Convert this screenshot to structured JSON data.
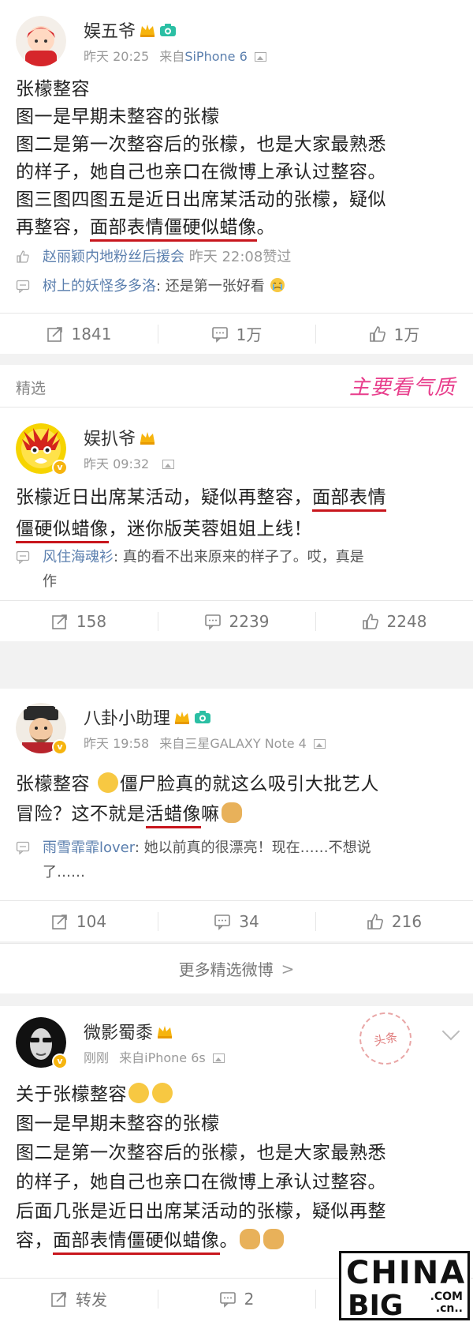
{
  "posts": [
    {
      "username": "娱五爷",
      "time": "昨天 20:25",
      "source_prefix": "来自",
      "source": "SiPhone 6",
      "body_lines": [
        {
          "pre": "张檬整容",
          "hl": "",
          "post": ""
        },
        {
          "pre": "图一是早期未整容的张檬",
          "hl": "",
          "post": ""
        },
        {
          "pre": "图二是第一次整容后的张檬，也是大家最熟悉",
          "hl": "",
          "post": ""
        },
        {
          "pre": "的样子，她自己也亲口在微博上承认过整容。",
          "hl": "",
          "post": ""
        },
        {
          "pre": "图三图四图五是近日出席某活动的张檬，疑似",
          "hl": "",
          "post": ""
        },
        {
          "pre": "再整容，",
          "hl": "面部表情僵硬似蜡像",
          "post": "。"
        }
      ],
      "like_user": "赵丽颖内地粉丝后援会",
      "like_time": "昨天 22:08赞过",
      "comment_user": "树上的妖怪多多洛",
      "comment_text": ": 还是第一张好看",
      "repost": "1841",
      "comments": "1万",
      "likes": "1万"
    },
    {
      "section": "精选",
      "section_art": "主要看气质",
      "username": "娱扒爷",
      "time": "昨天 09:32",
      "body_l1_pre": "张檬近日出席某活动，疑似再整容，",
      "body_l1_hl": "面部表情",
      "body_l2_hl": "僵硬似蜡像",
      "body_l2_post": "，迷你版芙蓉姐姐上线！",
      "comment_user": "风住海魂衫",
      "comment_text": ": 真的看不出来原来的样子了。哎，真是",
      "comment_text2": "作",
      "repost": "158",
      "comments": "2239",
      "likes": "2248"
    },
    {
      "username": "八卦小助理",
      "time": "昨天 19:58",
      "source_prefix": "来自",
      "source": "三星GALAXY Note 4",
      "body_l1_pre": "张檬整容",
      "body_l1_post": "僵尸脸真的就这么吸引大批艺人",
      "body_l2_pre": "冒险？这不就是",
      "body_l2_hl": "活蜡像",
      "body_l2_post": "嘛",
      "comment_user": "雨雪霏霏lover",
      "comment_text": ": 她以前真的很漂亮！现在……不想说",
      "comment_text2": "了……",
      "repost": "104",
      "comments": "34",
      "likes": "216"
    },
    {
      "username": "微影蜀黍",
      "time": "刚刚",
      "source_prefix": "来自",
      "source": "iPhone 6s",
      "stamp": "头条",
      "body_l1": "关于张檬整容",
      "body_l2": "图一是早期未整容的张檬",
      "body_l3": "图二是第一次整容后的张檬，也是大家最熟悉",
      "body_l4": "的样子，她自己也亲口在微博上承认过整容。",
      "body_l5": "后面几张是近日出席某活动的张檬，疑似再整",
      "body_l6_pre": "容，",
      "body_l6_hl": "面部表情僵硬似蜡像",
      "body_l6_post": "。",
      "repost_label": "转发",
      "comments": "2"
    }
  ],
  "more_label": "更多精选微博",
  "more_chevron": ">",
  "watermark": {
    "title": "CHINA",
    "sub": "BIG",
    "domain1": ".COM",
    "domain2": ".cn.."
  },
  "colors": {
    "link": "#5b7fae",
    "underline": "#c8161d",
    "meta": "#999999"
  }
}
